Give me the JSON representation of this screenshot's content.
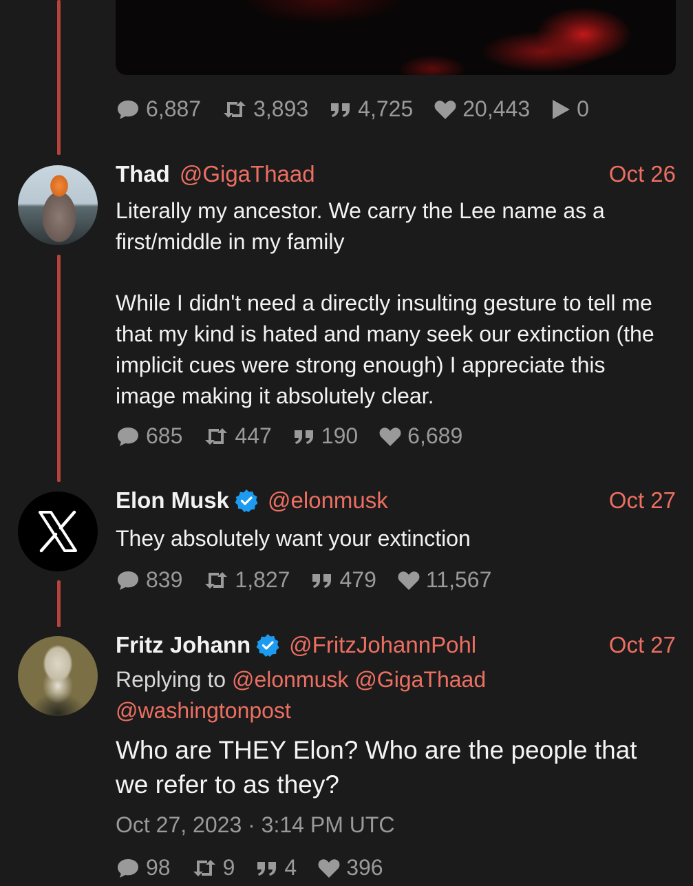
{
  "colors": {
    "background": "#1b1b1b",
    "accent": "#ec6f62",
    "thread_line": "#b8433d",
    "muted": "#9a9a9a",
    "verified": "#1d9bf0"
  },
  "icons": {
    "reply": "speech-bubble-icon",
    "retweet": "retweet-icon",
    "quote": "quote-icon",
    "like": "heart-icon",
    "views": "play-icon",
    "verified": "verified-badge-icon"
  },
  "top_post": {
    "stats": {
      "replies": "6,887",
      "retweets": "3,893",
      "quotes": "4,725",
      "likes": "20,443",
      "views": "0"
    }
  },
  "tweets": [
    {
      "name": "Thad",
      "handle": "@GigaThaad",
      "date": "Oct 26",
      "verified": false,
      "body_p1": "Literally my ancestor. We carry the Lee name as a first/middle in my family",
      "body_p2": "While I didn't need a directly insulting gesture to tell me that my kind is hated and many seek our extinction (the implicit cues were strong enough) I appreciate this image making it absolutely clear.",
      "stats": {
        "replies": "685",
        "retweets": "447",
        "quotes": "190",
        "likes": "6,689"
      }
    },
    {
      "name": "Elon Musk",
      "handle": "@elonmusk",
      "date": "Oct 27",
      "verified": true,
      "body": "They absolutely want your extinction",
      "stats": {
        "replies": "839",
        "retweets": "1,827",
        "quotes": "479",
        "likes": "11,567"
      }
    },
    {
      "name": "Fritz Johann",
      "handle": "@FritzJohannPohl",
      "date": "Oct 27",
      "verified": true,
      "replying_prefix": "Replying to",
      "replying_to": [
        "@elonmusk",
        "@GigaThaad",
        "@washingtonpost"
      ],
      "body": "Who are THEY Elon? Who are the people that we refer to as they?",
      "timestamp": "Oct 27, 2023 · 3:14 PM UTC",
      "stats": {
        "replies": "98",
        "retweets": "9",
        "quotes": "4",
        "likes": "396"
      }
    }
  ]
}
